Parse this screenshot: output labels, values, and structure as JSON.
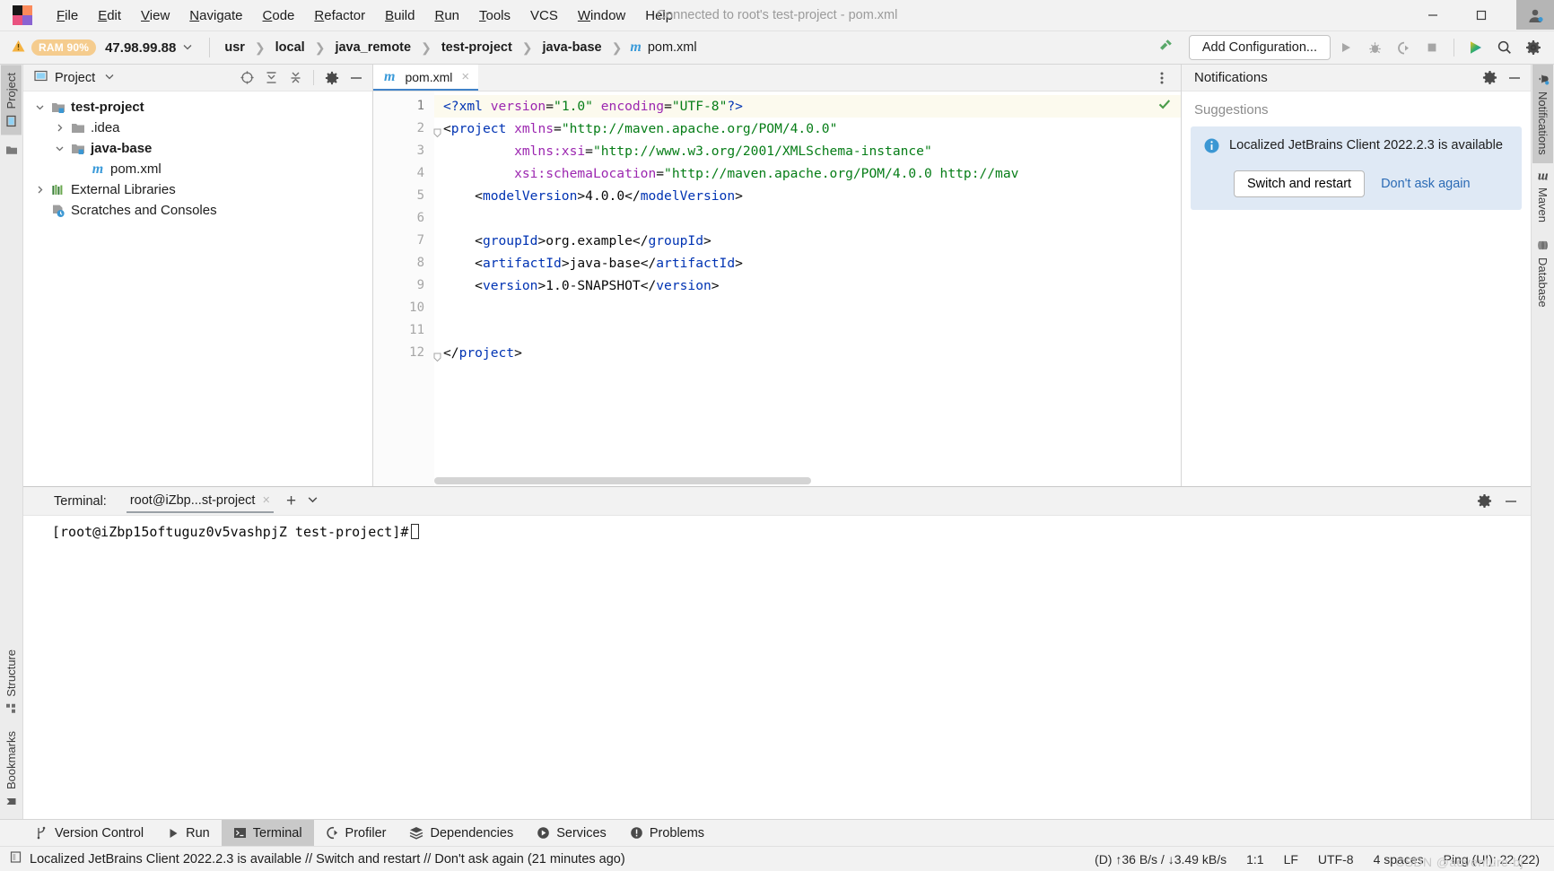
{
  "titlebar": {
    "menus": [
      {
        "label": "File",
        "mnemonic": "F"
      },
      {
        "label": "Edit",
        "mnemonic": "E"
      },
      {
        "label": "View",
        "mnemonic": "V"
      },
      {
        "label": "Navigate",
        "mnemonic": "N"
      },
      {
        "label": "Code",
        "mnemonic": "C"
      },
      {
        "label": "Refactor",
        "mnemonic": "R"
      },
      {
        "label": "Build",
        "mnemonic": "B"
      },
      {
        "label": "Run",
        "mnemonic": "R"
      },
      {
        "label": "Tools",
        "mnemonic": "T"
      },
      {
        "label": "VCS",
        "mnemonic": ""
      },
      {
        "label": "Window",
        "mnemonic": "W"
      },
      {
        "label": "Help",
        "mnemonic": ""
      }
    ],
    "window_title": "Connected to root's test-project - pom.xml"
  },
  "navbar": {
    "ram_badge": "RAM 90%",
    "host": "47.98.99.88",
    "breadcrumbs": [
      "usr",
      "local",
      "java_remote",
      "test-project",
      "java-base",
      "pom.xml"
    ],
    "add_configuration": "Add Configuration..."
  },
  "left_rail": {
    "top": [
      {
        "label": "Project",
        "active": true
      }
    ],
    "bottom": [
      {
        "label": "Structure"
      },
      {
        "label": "Bookmarks"
      }
    ]
  },
  "right_rail": [
    {
      "label": "Notifications",
      "active": true
    },
    {
      "label": "Maven",
      "active": false
    },
    {
      "label": "Database",
      "active": false
    }
  ],
  "project": {
    "title": "Project",
    "tree": [
      {
        "label": "test-project",
        "level": 0,
        "arrow": "down",
        "icon": "module-folder-icon",
        "bold": true
      },
      {
        "label": ".idea",
        "level": 1,
        "arrow": "right",
        "icon": "folder-icon",
        "bold": false
      },
      {
        "label": "java-base",
        "level": 1,
        "arrow": "down",
        "icon": "module-folder-icon",
        "bold": true
      },
      {
        "label": "pom.xml",
        "level": 2,
        "arrow": "none",
        "icon": "maven-file-icon",
        "bold": false
      },
      {
        "label": "External Libraries",
        "level": 0,
        "arrow": "right",
        "icon": "libraries-icon",
        "bold": false
      },
      {
        "label": "Scratches and Consoles",
        "level": 0,
        "arrow": "none",
        "icon": "scratches-icon",
        "bold": false
      }
    ]
  },
  "editor": {
    "tab": "pom.xml",
    "lines": [
      {
        "n": "1",
        "highlight": true,
        "fold": false,
        "segments": [
          {
            "t": "<?xml ",
            "c": "pi"
          },
          {
            "t": "version",
            "c": "attr"
          },
          {
            "t": "=",
            "c": "txt"
          },
          {
            "t": "\"1.0\"",
            "c": "val"
          },
          {
            "t": " ",
            "c": "txt"
          },
          {
            "t": "encoding",
            "c": "attr"
          },
          {
            "t": "=",
            "c": "txt"
          },
          {
            "t": "\"UTF-8\"",
            "c": "val"
          },
          {
            "t": "?>",
            "c": "pi"
          }
        ]
      },
      {
        "n": "2",
        "highlight": false,
        "fold": true,
        "segments": [
          {
            "t": "<",
            "c": "txt"
          },
          {
            "t": "project",
            "c": "tag"
          },
          {
            "t": " ",
            "c": "txt"
          },
          {
            "t": "xmlns",
            "c": "attr"
          },
          {
            "t": "=",
            "c": "txt"
          },
          {
            "t": "\"http://maven.apache.org/POM/4.0.0\"",
            "c": "val"
          }
        ]
      },
      {
        "n": "3",
        "highlight": false,
        "fold": false,
        "segments": [
          {
            "t": "         ",
            "c": "txt"
          },
          {
            "t": "xmlns:xsi",
            "c": "attr"
          },
          {
            "t": "=",
            "c": "txt"
          },
          {
            "t": "\"http://www.w3.org/2001/XMLSchema-instance\"",
            "c": "val"
          }
        ]
      },
      {
        "n": "4",
        "highlight": false,
        "fold": false,
        "segments": [
          {
            "t": "         ",
            "c": "txt"
          },
          {
            "t": "xsi:schemaLocation",
            "c": "attr"
          },
          {
            "t": "=",
            "c": "txt"
          },
          {
            "t": "\"http://maven.apache.org/POM/4.0.0 http://mav",
            "c": "val"
          }
        ]
      },
      {
        "n": "5",
        "highlight": false,
        "fold": false,
        "segments": [
          {
            "t": "    <",
            "c": "txt"
          },
          {
            "t": "modelVersion",
            "c": "tag"
          },
          {
            "t": ">",
            "c": "txt"
          },
          {
            "t": "4.0.0",
            "c": "txt"
          },
          {
            "t": "</",
            "c": "txt"
          },
          {
            "t": "modelVersion",
            "c": "tag"
          },
          {
            "t": ">",
            "c": "txt"
          }
        ]
      },
      {
        "n": "6",
        "highlight": false,
        "fold": false,
        "segments": []
      },
      {
        "n": "7",
        "highlight": false,
        "fold": false,
        "segments": [
          {
            "t": "    <",
            "c": "txt"
          },
          {
            "t": "groupId",
            "c": "tag"
          },
          {
            "t": ">",
            "c": "txt"
          },
          {
            "t": "org.example",
            "c": "txt"
          },
          {
            "t": "</",
            "c": "txt"
          },
          {
            "t": "groupId",
            "c": "tag"
          },
          {
            "t": ">",
            "c": "txt"
          }
        ]
      },
      {
        "n": "8",
        "highlight": false,
        "fold": false,
        "segments": [
          {
            "t": "    <",
            "c": "txt"
          },
          {
            "t": "artifactId",
            "c": "tag"
          },
          {
            "t": ">",
            "c": "txt"
          },
          {
            "t": "java-base",
            "c": "txt"
          },
          {
            "t": "</",
            "c": "txt"
          },
          {
            "t": "artifactId",
            "c": "tag"
          },
          {
            "t": ">",
            "c": "txt"
          }
        ]
      },
      {
        "n": "9",
        "highlight": false,
        "fold": false,
        "segments": [
          {
            "t": "    <",
            "c": "txt"
          },
          {
            "t": "version",
            "c": "tag"
          },
          {
            "t": ">",
            "c": "txt"
          },
          {
            "t": "1.0-SNAPSHOT",
            "c": "txt"
          },
          {
            "t": "</",
            "c": "txt"
          },
          {
            "t": "version",
            "c": "tag"
          },
          {
            "t": ">",
            "c": "txt"
          }
        ]
      },
      {
        "n": "10",
        "highlight": false,
        "fold": false,
        "segments": []
      },
      {
        "n": "11",
        "highlight": false,
        "fold": false,
        "segments": []
      },
      {
        "n": "12",
        "highlight": false,
        "fold": true,
        "segments": [
          {
            "t": "</",
            "c": "txt"
          },
          {
            "t": "project",
            "c": "tag"
          },
          {
            "t": ">",
            "c": "txt"
          }
        ]
      }
    ]
  },
  "notifications": {
    "title": "Notifications",
    "section_label": "Suggestions",
    "card": {
      "message": "Localized JetBrains Client 2022.2.3 is available",
      "primary_action": "Switch and restart",
      "secondary_action": "Don't ask again"
    }
  },
  "terminal": {
    "label": "Terminal:",
    "tab": "root@iZbp...st-project",
    "prompt": "[root@iZbp15oftuguz0v5vashpjZ test-project]#"
  },
  "bottom_tabs": [
    {
      "label": "Version Control",
      "icon": "branch-icon",
      "active": false
    },
    {
      "label": "Run",
      "icon": "play-icon",
      "active": false
    },
    {
      "label": "Terminal",
      "icon": "terminal-icon",
      "active": true
    },
    {
      "label": "Profiler",
      "icon": "profiler-icon",
      "active": false
    },
    {
      "label": "Dependencies",
      "icon": "layers-icon",
      "active": false
    },
    {
      "label": "Services",
      "icon": "services-icon",
      "active": false
    },
    {
      "label": "Problems",
      "icon": "problems-icon",
      "active": false
    }
  ],
  "statusbar": {
    "message": "Localized JetBrains Client 2022.2.3 is available // Switch and restart // Don't ask again (21 minutes ago)",
    "network": "(D) ↑36 B/s / ↓3.49 kB/s",
    "caret": "1:1",
    "line_sep": "LF",
    "encoding": "UTF-8",
    "indent": "4 spaces",
    "ping": "Ping (UI): 22 (22)",
    "watermark": "CSDN @adventure-bj"
  },
  "colors": {
    "accent": "#4083c9",
    "link": "#2b6bb5",
    "notif_card_bg": "#dfe9f5",
    "xml_tag": "#0033b3",
    "xml_attr": "#9c27b0",
    "xml_value": "#067d17",
    "ram_badge_bg": "#f5cc8e"
  }
}
